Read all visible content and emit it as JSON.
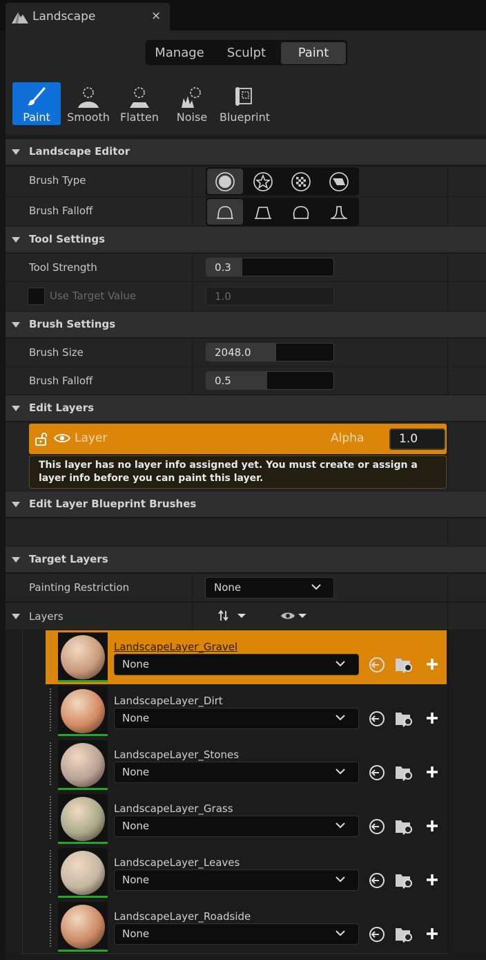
{
  "tab": {
    "title": "Landscape",
    "close": "×"
  },
  "modes": [
    "Manage",
    "Sculpt",
    "Paint"
  ],
  "active_mode": "Paint",
  "tools": [
    {
      "label": "Paint",
      "icon": "paint-brush-icon",
      "active": true
    },
    {
      "label": "Smooth",
      "icon": "smooth-icon",
      "active": false
    },
    {
      "label": "Flatten",
      "icon": "flatten-icon",
      "active": false
    },
    {
      "label": "Noise",
      "icon": "noise-icon",
      "active": false
    },
    {
      "label": "Blueprint",
      "icon": "blueprint-icon",
      "active": false
    }
  ],
  "sections": {
    "landscape_editor": "Landscape Editor",
    "tool_settings": "Tool Settings",
    "brush_settings": "Brush Settings",
    "edit_layers": "Edit Layers",
    "edit_layer_bp": "Edit Layer Blueprint Brushes",
    "target_layers": "Target Layers"
  },
  "props": {
    "brush_type": "Brush Type",
    "brush_falloff_type": "Brush Falloff",
    "tool_strength": {
      "label": "Tool Strength",
      "value": "0.3",
      "fill_fraction": 0.28
    },
    "use_target_value": {
      "label": "Use Target Value",
      "value": "1.0",
      "checked": false
    },
    "brush_size": {
      "label": "Brush Size",
      "value": "2048.0",
      "fill_fraction": 0.55
    },
    "brush_falloff": {
      "label": "Brush Falloff",
      "value": "0.5",
      "fill_fraction": 0.48
    },
    "painting_restriction": {
      "label": "Painting Restriction",
      "value": "None"
    },
    "layers": "Layers"
  },
  "brush_types": [
    {
      "icon": "circle-brush-icon",
      "active": true
    },
    {
      "icon": "alpha-brush-icon",
      "active": false
    },
    {
      "icon": "pattern-brush-icon",
      "active": false
    },
    {
      "icon": "gizmo-brush-icon",
      "active": false
    }
  ],
  "falloff_types": [
    {
      "icon": "smooth-falloff-icon",
      "active": true
    },
    {
      "icon": "linear-falloff-icon",
      "active": false
    },
    {
      "icon": "spherical-falloff-icon",
      "active": false
    },
    {
      "icon": "tip-falloff-icon",
      "active": false
    }
  ],
  "edit_layer": {
    "name": "Layer",
    "alpha_label": "Alpha",
    "alpha": "1.0"
  },
  "warning": "This layer has no layer info assigned yet. You must create or assign a layer info before you can paint this layer.",
  "target_layers": [
    {
      "name": "LandscapeLayer_Gravel",
      "value": "None",
      "selected": true,
      "color": "#c99a7a"
    },
    {
      "name": "LandscapeLayer_Dirt",
      "value": "None",
      "selected": false,
      "color": "#d38a62"
    },
    {
      "name": "LandscapeLayer_Stones",
      "value": "None",
      "selected": false,
      "color": "#b8a294"
    },
    {
      "name": "LandscapeLayer_Grass",
      "value": "None",
      "selected": false,
      "color": "#a8aa8a"
    },
    {
      "name": "LandscapeLayer_Leaves",
      "value": "None",
      "selected": false,
      "color": "#c2b7a2"
    },
    {
      "name": "LandscapeLayer_Roadside",
      "value": "None",
      "selected": false,
      "color": "#cc8964"
    }
  ]
}
